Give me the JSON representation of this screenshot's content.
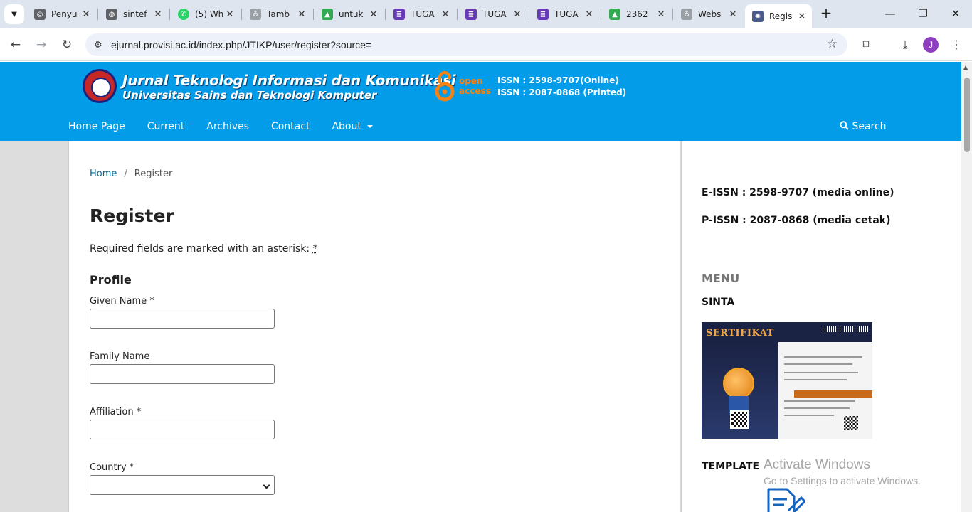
{
  "browser": {
    "tabs": [
      {
        "title": "Penyu",
        "color": "#5f6368",
        "glyph": "◎"
      },
      {
        "title": "sintef",
        "color": "#5f6368",
        "glyph": "◍"
      },
      {
        "title": "(5) Wh",
        "color": "#25d366",
        "glyph": "✆"
      },
      {
        "title": "Tamb",
        "color": "#5f6368",
        "glyph": "♁"
      },
      {
        "title": "untuk",
        "color": "#34a853",
        "glyph": "▲"
      },
      {
        "title": "TUGA",
        "color": "#673ab7",
        "glyph": "≣"
      },
      {
        "title": "TUGA",
        "color": "#673ab7",
        "glyph": "≣"
      },
      {
        "title": "TUGA",
        "color": "#673ab7",
        "glyph": "≣"
      },
      {
        "title": "2362",
        "color": "#34a853",
        "glyph": "▲"
      },
      {
        "title": "Webs",
        "color": "#5f6368",
        "glyph": "♁"
      },
      {
        "title": "Regis",
        "color": "#5f6368",
        "glyph": "✺"
      }
    ],
    "active_tab_index": 10,
    "url": "ejurnal.provisi.ac.id/index.php/JTIKP/user/register?source=",
    "profile_initial": "J"
  },
  "header": {
    "title": "Jurnal Teknologi Informasi dan Komunikasi",
    "subtitle": "Universitas Sains dan Teknologi Komputer",
    "oa_line1": "open",
    "oa_line2": "access",
    "issn_online": "ISSN : 2598-9707(Online)",
    "issn_printed": "ISSN : 2087-0868 (Printed)",
    "colors": {
      "header_bg": "#039ce8",
      "oa_orange": "#f68212"
    }
  },
  "nav": {
    "items": [
      "Home Page",
      "Current",
      "Archives",
      "Contact",
      "About"
    ],
    "search_label": "Search"
  },
  "breadcrumb": {
    "home": "Home",
    "separator": "/",
    "current": "Register"
  },
  "form": {
    "title": "Register",
    "required_note": "Required fields are marked with an asterisk: ",
    "asterisk": "*",
    "section_profile": "Profile",
    "given_name_label": "Given Name *",
    "family_name_label": "Family Name",
    "affiliation_label": "Affiliation *",
    "country_label": "Country *"
  },
  "sidebar": {
    "eissn": "E-ISSN : 2598-9707 (media online)",
    "pissn": "P-ISSN : 2087-0868 (media cetak)",
    "menu_heading": "MENU",
    "sinta_heading": "SINTA",
    "certificate_title": "SERTIFIKAT",
    "template_heading": "TEMPLATE"
  },
  "watermark": {
    "line1": "Activate Windows",
    "line2": "Go to Settings to activate Windows."
  }
}
